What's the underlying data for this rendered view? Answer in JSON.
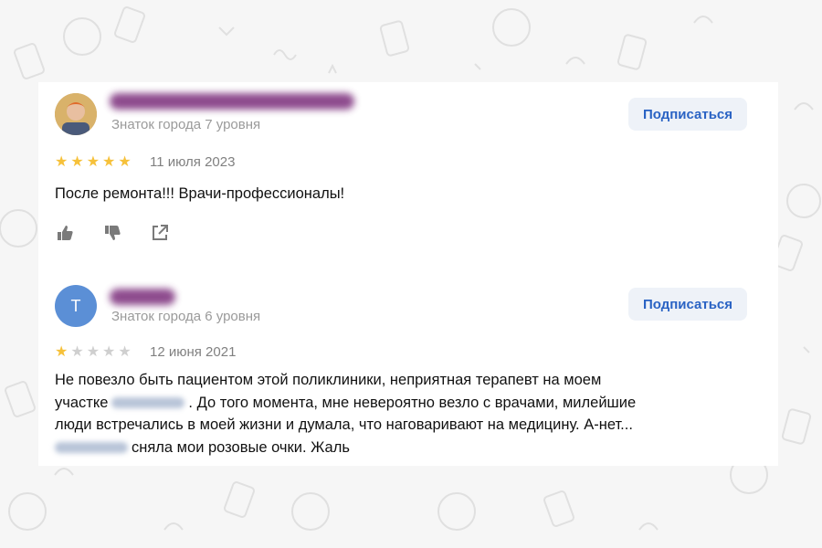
{
  "colors": {
    "accent": "#2a63c4",
    "star_active": "#f6c13a",
    "star_inactive": "#cfcfcf",
    "avatar_letter_bg": "#5b8fd6"
  },
  "reviews": [
    {
      "badge": "Знаток города 7 уровня",
      "subscribe_label": "Подписаться",
      "rating": 5,
      "date": "11 июля 2023",
      "text": "После ремонта!!! Врачи-профессионалы!",
      "actions": [
        "like-icon",
        "dislike-icon",
        "share-icon"
      ]
    },
    {
      "avatar_letter": "Т",
      "badge": "Знаток города 6 уровня",
      "subscribe_label": "Подписаться",
      "rating": 1,
      "date": "12 июня 2021",
      "text_lines": [
        "Не повезло быть пациентом этой поликлиники, неприятная терапевт на моем",
        "участке",
        ". До того момента, мне невероятно везло с врачами, милейшие",
        "люди встречались в моей жизни и думала, что наговаривают на медицину. А-нет...",
        "сняла мои розовые очки. Жаль"
      ]
    }
  ]
}
